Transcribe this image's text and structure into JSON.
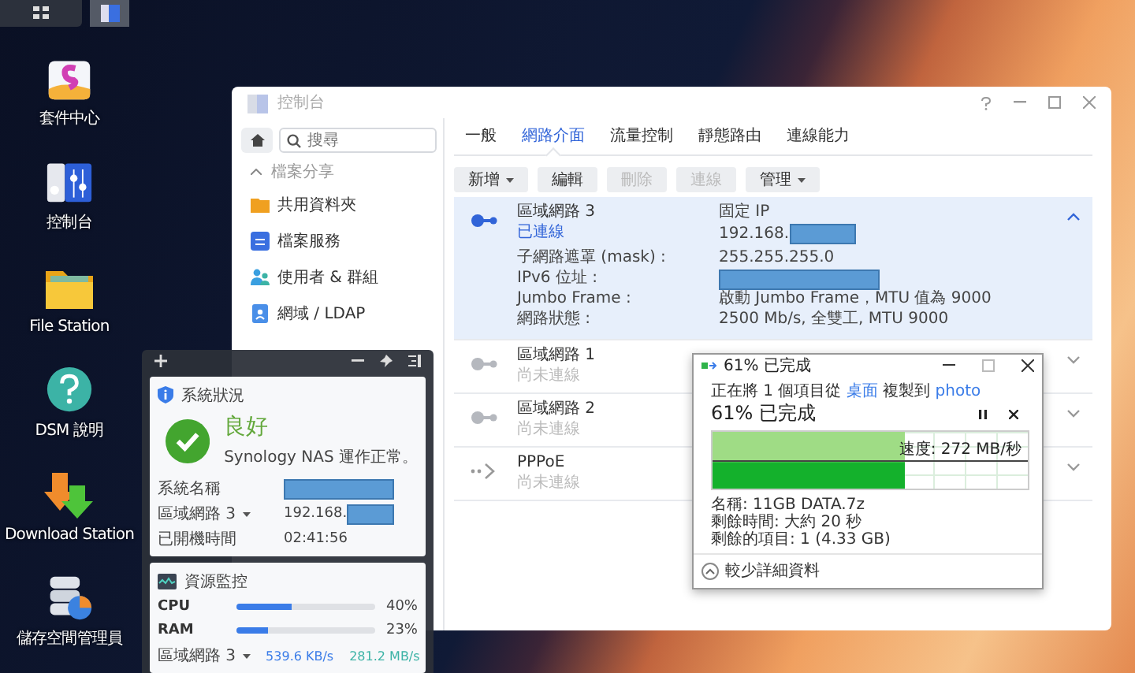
{
  "desktop_icons": [
    {
      "label": "套件中心",
      "kind": "package"
    },
    {
      "label": "控制台",
      "kind": "control"
    },
    {
      "label": "File Station",
      "kind": "folder"
    },
    {
      "label": "DSM 說明",
      "kind": "help"
    },
    {
      "label": "Download Station",
      "kind": "download"
    },
    {
      "label": "儲存空間管理員",
      "kind": "storage"
    }
  ],
  "control_panel": {
    "title": "控制台",
    "search": {
      "placeholder": "搜尋"
    },
    "sidebar": {
      "section": "檔案分享",
      "expanded": true,
      "items": [
        {
          "label": "共用資料夾",
          "kind": "folder"
        },
        {
          "label": "檔案服務",
          "kind": "files"
        },
        {
          "label": "使用者 & 群組",
          "kind": "users"
        },
        {
          "label": "網域 / LDAP",
          "kind": "domain"
        }
      ]
    },
    "tabs": [
      {
        "label": "一般",
        "selected": false
      },
      {
        "label": "網路介面",
        "selected": true
      },
      {
        "label": "流量控制",
        "selected": false
      },
      {
        "label": "靜態路由",
        "selected": false
      },
      {
        "label": "連線能力",
        "selected": false
      }
    ],
    "toolbar": [
      {
        "label": "新增",
        "dropdown": true,
        "disabled": false
      },
      {
        "label": "編輯",
        "dropdown": false,
        "disabled": false
      },
      {
        "label": "刪除",
        "dropdown": false,
        "disabled": true
      },
      {
        "label": "連線",
        "dropdown": false,
        "disabled": true
      },
      {
        "label": "管理",
        "dropdown": true,
        "disabled": false
      }
    ],
    "interfaces": [
      {
        "name": "區域網路 3",
        "status": "已連線",
        "kind": "lan",
        "connected": true,
        "expanded": true,
        "mode": "固定 IP",
        "ip": "192.168.",
        "ip_redacted": true,
        "details": [
          {
            "label": "子網路遮罩 (mask) :",
            "value": "255.255.255.0"
          },
          {
            "label": "IPv6 位址 :",
            "redacted": true
          },
          {
            "label": "Jumbo Frame :",
            "value": "啟動 Jumbo Frame，MTU 值為 9000"
          },
          {
            "label": "網路狀態 :",
            "value": "2500 Mb/s, 全雙工, MTU 9000"
          }
        ]
      },
      {
        "name": "區域網路 1",
        "status": "尚未連線",
        "kind": "lan",
        "connected": false,
        "expanded": false
      },
      {
        "name": "區域網路 2",
        "status": "尚未連線",
        "kind": "lan",
        "connected": false,
        "expanded": false
      },
      {
        "name": "PPPoE",
        "status": "尚未連線",
        "kind": "pppoe",
        "connected": false,
        "expanded": false
      }
    ]
  },
  "widgets": {
    "status": {
      "title": "系統狀況",
      "health": "良好",
      "message": "Synology NAS 運作正常。",
      "rows": [
        {
          "label": "系統名稱",
          "dropdown": false,
          "redacted": true
        },
        {
          "label": "區域網路 3",
          "dropdown": true,
          "value": "192.168.",
          "redacted": true
        },
        {
          "label": "已開機時間",
          "dropdown": false,
          "value": "02:41:56"
        }
      ]
    },
    "monitor": {
      "title": "資源監控",
      "meters": [
        {
          "label": "CPU",
          "level": 0.4,
          "reading": "40%"
        },
        {
          "label": "RAM",
          "level": 0.23,
          "reading": "23%"
        }
      ],
      "network": {
        "label": "區域網路 3",
        "upload": "539.6 KB/s",
        "download": "281.2 MB/s"
      }
    }
  },
  "copy_dialog": {
    "title": "61% 已完成",
    "prefix": "正在將 1 個項目從",
    "source": "桌面",
    "middle": "複製到",
    "destination": "photo",
    "heading": "61% 已完成",
    "level": 0.61,
    "speed": "速度: 272 MB/秒",
    "details": [
      "名稱: 11GB DATA.7z",
      "剩餘時間: 大約 20 秒",
      "剩餘的項目: 1 (4.33 GB)"
    ],
    "less_details": "較少詳細資料"
  }
}
